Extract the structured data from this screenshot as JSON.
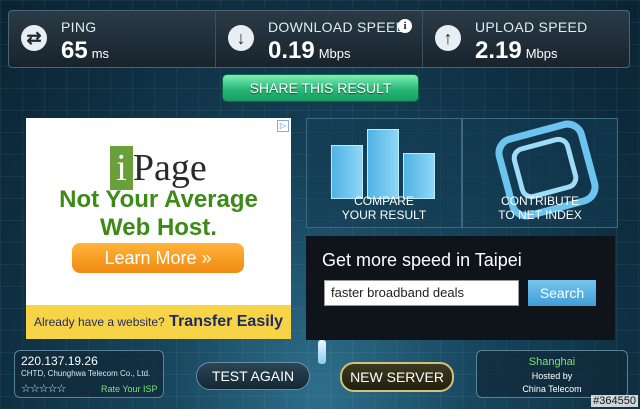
{
  "stats": {
    "ping": {
      "label": "PING",
      "value": "65",
      "unit": "ms"
    },
    "download": {
      "label": "DOWNLOAD SPEED",
      "value": "0.19",
      "unit": "Mbps"
    },
    "upload": {
      "label": "UPLOAD SPEED",
      "value": "2.19",
      "unit": "Mbps"
    }
  },
  "share_label": "SHARE THIS RESULT",
  "ad": {
    "logo_i": "i",
    "logo_rest": "Page",
    "headline_line1": "Not Your Average",
    "headline_line2": "Web Host.",
    "learn_more": "Learn More »",
    "footer_small": "Already have a website?",
    "footer_big": "Transfer Easily",
    "adchoices": "▷"
  },
  "tiles": {
    "compare_line1": "COMPARE",
    "compare_line2": "YOUR RESULT",
    "contribute_line1": "CONTRIBUTE",
    "contribute_line2": "TO NET INDEX"
  },
  "cta": {
    "heading": "Get more speed in Taipei",
    "input_value": "faster broadband deals",
    "search_label": "Search"
  },
  "isp": {
    "ip": "220.137.19.26",
    "name": "CHTD, Chunghwa Telecom Co., Ltd.",
    "stars": "☆☆☆☆☆",
    "rate_label": "Rate Your ISP"
  },
  "buttons": {
    "test_again": "TEST AGAIN",
    "new_server": "NEW SERVER"
  },
  "server": {
    "city": "Shanghai",
    "hosted_by": "Hosted by",
    "host": "China Telecom"
  },
  "watermark": "#364550",
  "colors": {
    "accent_green": "#27b877",
    "accent_blue": "#4fb3e6",
    "cta_bg": "#0e1419"
  }
}
